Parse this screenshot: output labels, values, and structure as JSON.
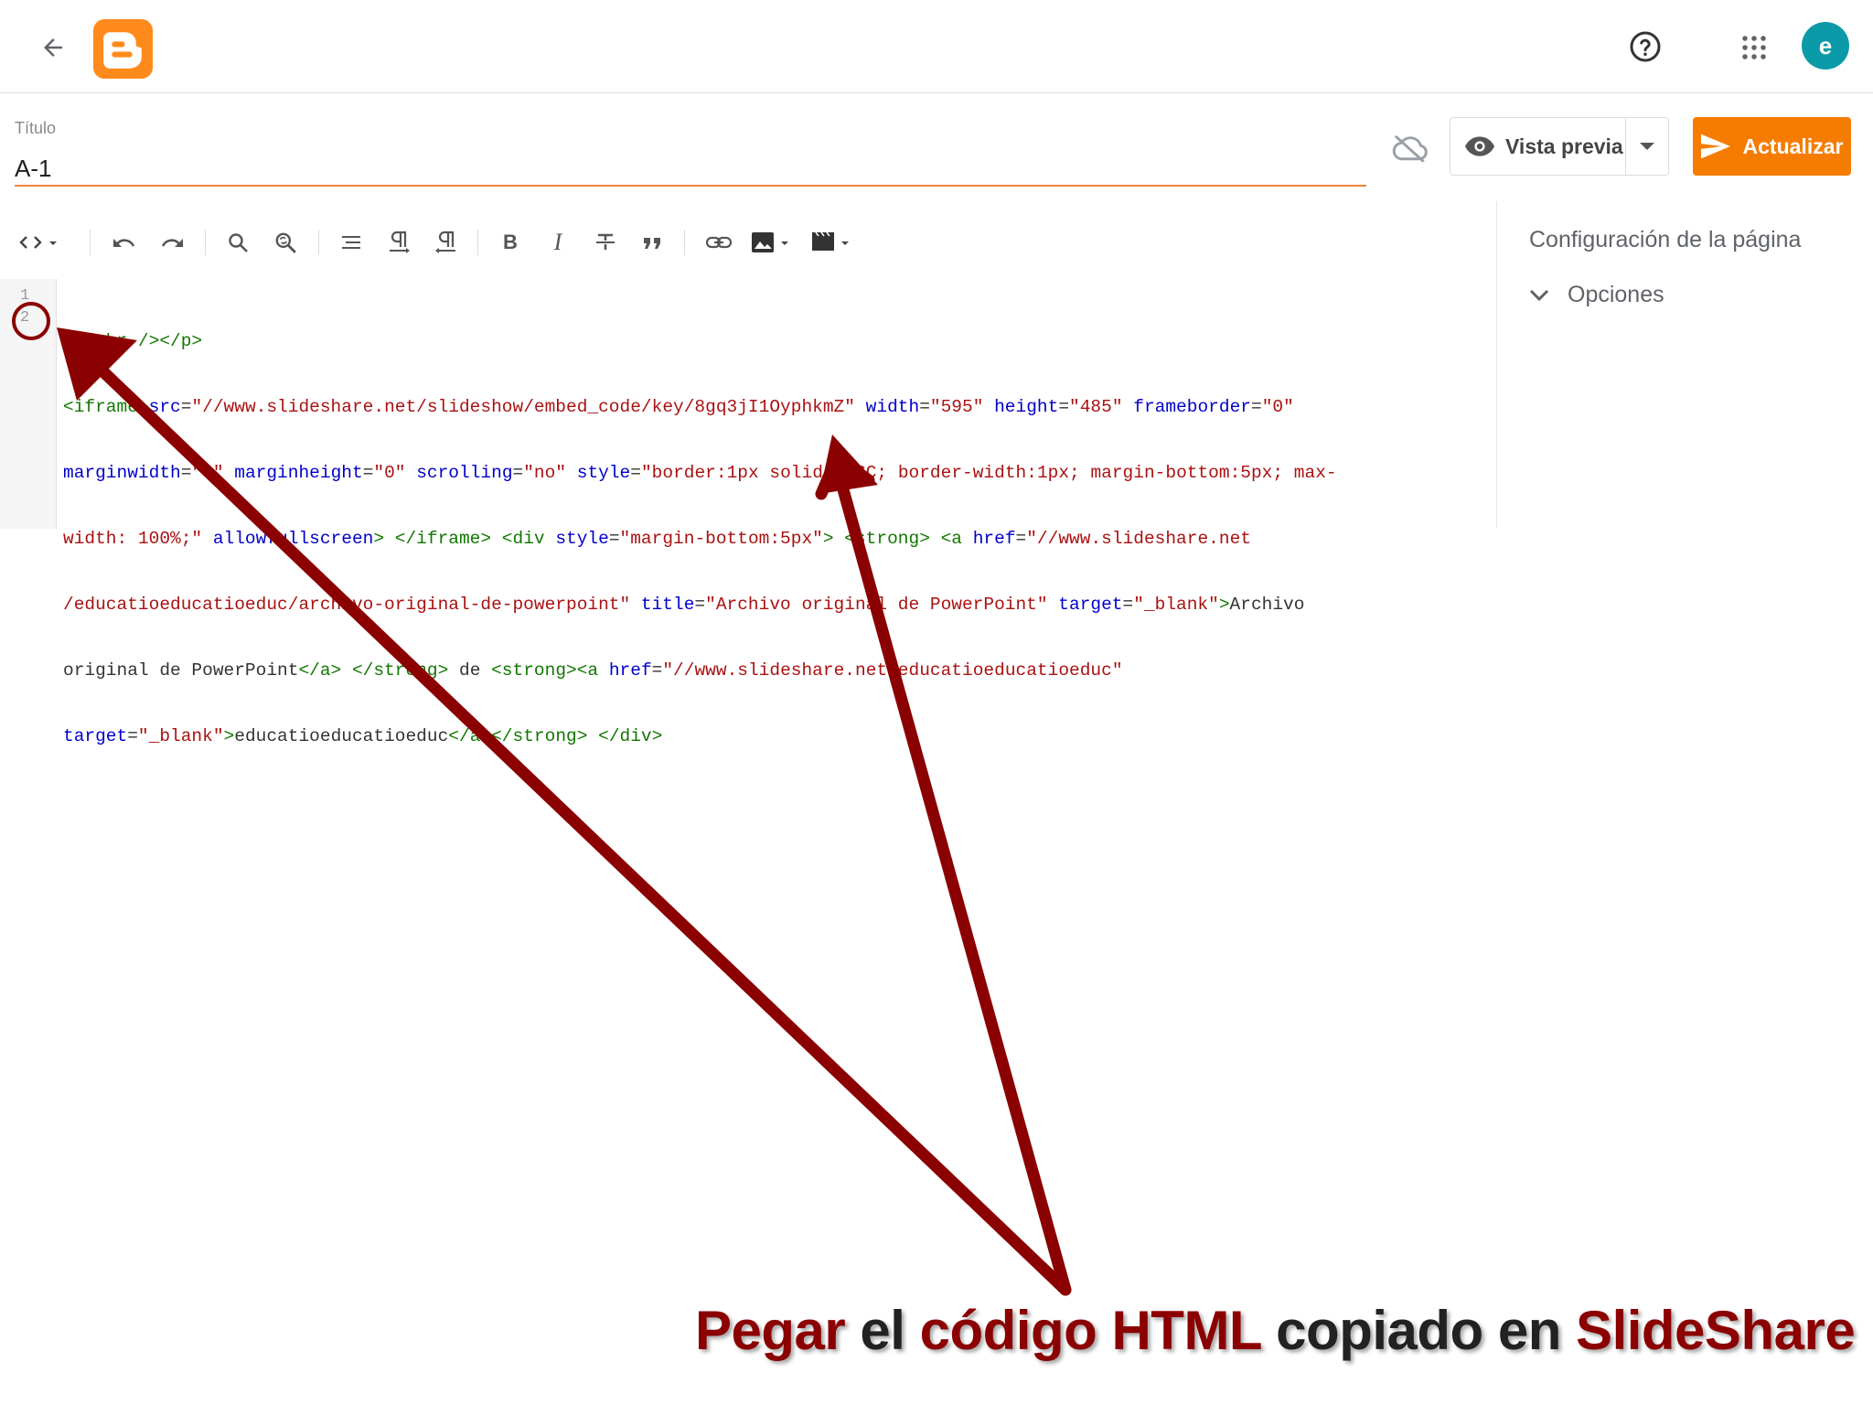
{
  "topbar": {
    "avatar_initial": "e"
  },
  "post": {
    "title_label": "Título",
    "title_value": "A-1"
  },
  "actions": {
    "preview_label": "Vista previa",
    "update_label": "Actualizar"
  },
  "editor": {
    "line_numbers": [
      "1",
      "2"
    ]
  },
  "side_panel": {
    "title": "Configuración de la página",
    "options_label": "Opciones"
  },
  "caption": {
    "p1": "Pegar",
    "p2": " el ",
    "p3": "código HTML",
    "p4": " copiado en ",
    "p5": "SlideShare"
  },
  "colors": {
    "accent": "#f57c00",
    "annotation": "#8b0000",
    "avatar": "#0b9aa7"
  }
}
